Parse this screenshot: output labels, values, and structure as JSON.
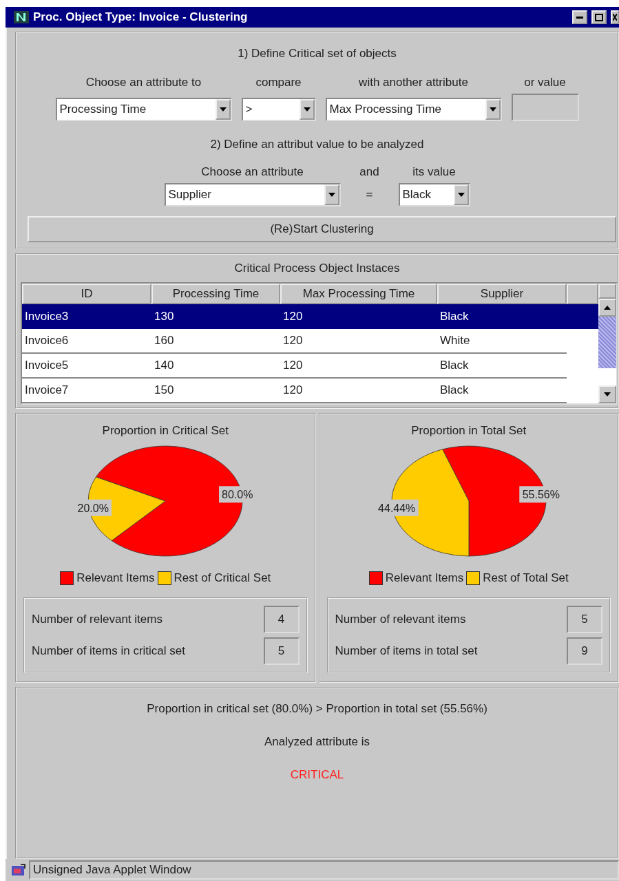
{
  "window": {
    "title": "Proc. Object Type: Invoice - Clustering"
  },
  "define_section": {
    "heading": "1) Define Critical set of objects",
    "columns": [
      {
        "label": "Choose an attribute to",
        "kind": "combo",
        "value": "Processing Time"
      },
      {
        "label": "compare",
        "kind": "combo",
        "value": ">"
      },
      {
        "label": "with another attribute",
        "kind": "combo",
        "value": "Max Processing Time"
      },
      {
        "label": "or value",
        "kind": "field"
      }
    ]
  },
  "analyze_section": {
    "heading": "2) Define an attribut value to be analyzed",
    "attribute": {
      "label": "Choose an attribute",
      "value": "Supplier"
    },
    "joiner": "and",
    "operator": "=",
    "value": {
      "label": "its value",
      "value": "Black"
    },
    "button": "(Re)Start Clustering"
  },
  "table": {
    "title": "Critical Process Object Instaces",
    "columns": [
      "ID",
      "Processing Time",
      "Max Processing Time",
      "Supplier"
    ],
    "rows": [
      {
        "cells": [
          "Invoice3",
          "130",
          "120",
          "Black"
        ],
        "selected": true
      },
      {
        "cells": [
          "Invoice6",
          "160",
          "120",
          "White"
        ],
        "selected": false
      },
      {
        "cells": [
          "Invoice5",
          "140",
          "120",
          "Black"
        ],
        "selected": false
      },
      {
        "cells": [
          "Invoice7",
          "150",
          "120",
          "Black"
        ],
        "selected": false
      }
    ]
  },
  "charts": [
    {
      "chart_data": {
        "type": "pie",
        "title": "Proportion in Critical Set",
        "categories": [
          "Relevant Items",
          "Rest of Critical Set"
        ],
        "values": [
          80.0,
          20.0
        ],
        "colors": [
          "#ff0000",
          "#ffcc00"
        ],
        "value_labels": [
          "80.0%",
          "20.0%"
        ]
      },
      "stats": [
        {
          "label": "Number of relevant items",
          "value": "4"
        },
        {
          "label": "Number of items in critical set",
          "value": "5"
        }
      ]
    },
    {
      "chart_data": {
        "type": "pie",
        "title": "Proportion in Total Set",
        "categories": [
          "Relevant Items",
          "Rest of Total Set"
        ],
        "values": [
          55.56,
          44.44
        ],
        "colors": [
          "#ff0000",
          "#ffcc00"
        ],
        "value_labels": [
          "55.56%",
          "44.44%"
        ]
      },
      "stats": [
        {
          "label": "Number of relevant items",
          "value": "5"
        },
        {
          "label": "Number of items in total set",
          "value": "9"
        }
      ]
    }
  ],
  "result": {
    "comparison": "Proportion in critical set (80.0%) > Proportion in total set (55.56%)",
    "statement": "Analyzed attribute is",
    "verdict": "CRITICAL"
  },
  "status_bar": {
    "text": "Unsigned Java Applet Window"
  }
}
